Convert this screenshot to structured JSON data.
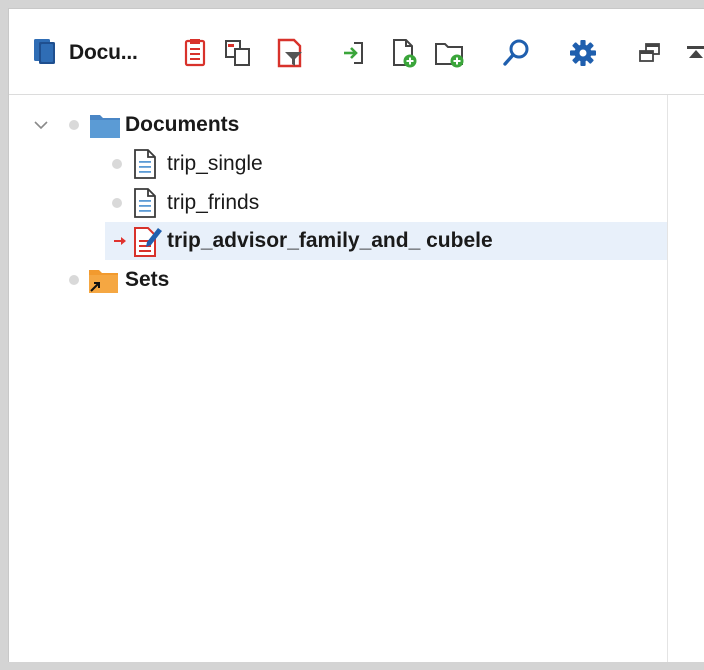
{
  "view": {
    "title": "Docu...",
    "title_icon": "documents-view-icon"
  },
  "toolbar": {
    "buttons": [
      {
        "name": "paste-document-icon"
      },
      {
        "name": "copy-document-icon"
      },
      {
        "name": "filter-documents-icon"
      },
      {
        "name": "import-icon"
      },
      {
        "name": "new-document-icon"
      },
      {
        "name": "new-folder-icon"
      },
      {
        "name": "search-icon"
      },
      {
        "name": "settings-gear-icon"
      },
      {
        "name": "restore-view-icon"
      },
      {
        "name": "maximize-view-icon"
      }
    ]
  },
  "tree": {
    "root": {
      "label": "Documents",
      "expanded": true,
      "children": [
        {
          "label": "trip_single",
          "type": "document",
          "active": false
        },
        {
          "label": "trip_frinds",
          "type": "document",
          "active": false
        },
        {
          "label": "trip_advisor_family_and_ cubele",
          "type": "document-edited",
          "active": true
        }
      ]
    },
    "sets": {
      "label": "Sets"
    }
  },
  "colors": {
    "folder_blue": "#5b9bd5",
    "folder_orange": "#f5a742",
    "accent_red": "#e0332e",
    "selection_bg": "#e8f0fa"
  }
}
